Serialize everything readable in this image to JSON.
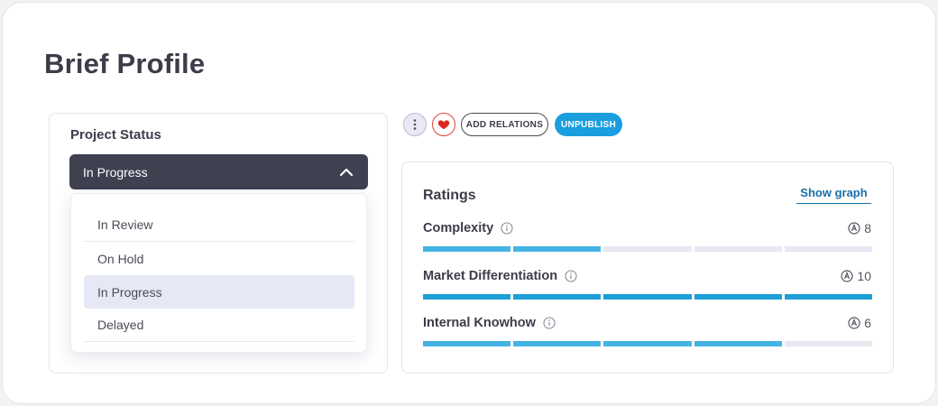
{
  "page": {
    "title": "Brief Profile"
  },
  "project_status": {
    "title": "Project Status",
    "selected": "In Progress",
    "options": [
      "In Review",
      "On Hold",
      "In Progress",
      "Delayed"
    ]
  },
  "actions": {
    "add_relations": "ADD RELATIONS",
    "unpublish": "UNPUBLISH",
    "more_icon": "vertical-dots-icon",
    "favorite_icon": "heart-icon"
  },
  "ratings": {
    "title": "Ratings",
    "show_graph": "Show graph",
    "items": [
      {
        "label": "Complexity",
        "score": "8",
        "filled_fraction": 0.4
      },
      {
        "label": "Market Differentiation",
        "score": "10",
        "filled_fraction": 1.0
      },
      {
        "label": "Internal Knowhow",
        "score": "6",
        "filled_fraction": 0.8
      }
    ]
  },
  "colors": {
    "accent": "#1a9ee0",
    "select_bg": "#3f4050",
    "favorite": "#e0433c",
    "bar_fill": "#1d9fd6",
    "bar_empty": "#e7e8f2"
  }
}
